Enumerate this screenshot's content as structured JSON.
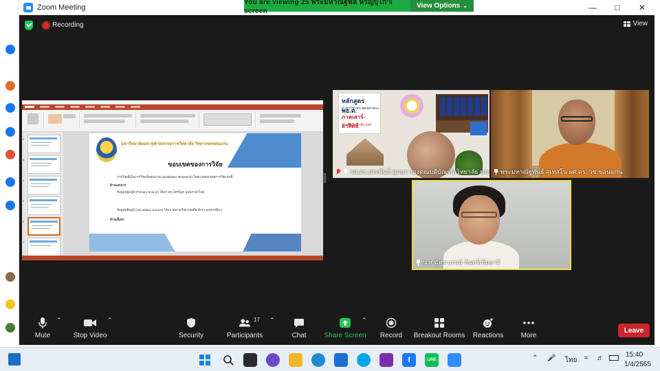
{
  "window": {
    "title": "Zoom Meeting",
    "viewing_banner": "You are viewing 25  พระมหาณัฐพล  หิรัญบุโก's screen",
    "view_options": "View Options",
    "recording_label": "Recording",
    "view_label": "View"
  },
  "shared_slide": {
    "university_name": "มหาวิทยาลัยมหาจุฬาลงกรณราชวิทยาลัย วิทยาเขตขอนแก่น",
    "heading": "ขอบเขตของการวิจัย",
    "line1": "การวิจัยนี้เป็นการวิจัยเชิงคุณภาพ (Qualitative Research) โดยแบ่งขอบเขตการวิจัย ดังนี้",
    "line2": "ด้านเอกสาร",
    "line3": "ข้อมูลปฐมภูมิ (Primary Source) ได้แก่ พระไตรปิฎก ฉบับภาษาไทย",
    "line4": "ข้อมูลทุติยภูมิ (Secondary Source) ได้แก่ ผลงานวิจัย หนังสือ ตำรา เอกสารอื่น ๆ",
    "line5": "ด้านเนื้อหา"
  },
  "participants": [
    {
      "name": "รศ.ดร.ประพันธ์ ศุภษร รองคณบดีบัณฑิตวิทยาลัย มจร",
      "muted": true,
      "pinned": true
    },
    {
      "name": "พระมหาณัฐพันธ์ สุเทสโน ผศ.ดร. วข.ขอนแก่น",
      "muted": false,
      "pinned": true
    },
    {
      "name": "น.ส ฉัตราภรณ์ จันทร์เจิมธารี",
      "muted": false,
      "pinned": true
    }
  ],
  "tile1_sign": {
    "line1": "หลักสูตร พธ.ด.",
    "line2": "สาขาวิชาพระพุทธศาสนา",
    "line3": "ภาคเสาร์-อาทิตย์",
    "line4": "บัณฑิตวิทยาลัย มจร"
  },
  "toolbar": {
    "mute": "Mute",
    "stop_video": "Stop Video",
    "security": "Security",
    "participants": "Participants",
    "participants_count": "17",
    "chat": "Chat",
    "share_screen": "Share Screen",
    "record": "Record",
    "breakout_rooms": "Breakout Rooms",
    "reactions": "Reactions",
    "more": "More",
    "leave": "Leave"
  },
  "taskbar": {
    "lang": "ไทย",
    "time": "15:40",
    "date": "1/4/2565"
  },
  "colors": {
    "zoom_blue": "#2d8cff",
    "banner_green": "#1eaa43",
    "leave_red": "#c8262c",
    "active_speaker": "#f0d94a"
  }
}
